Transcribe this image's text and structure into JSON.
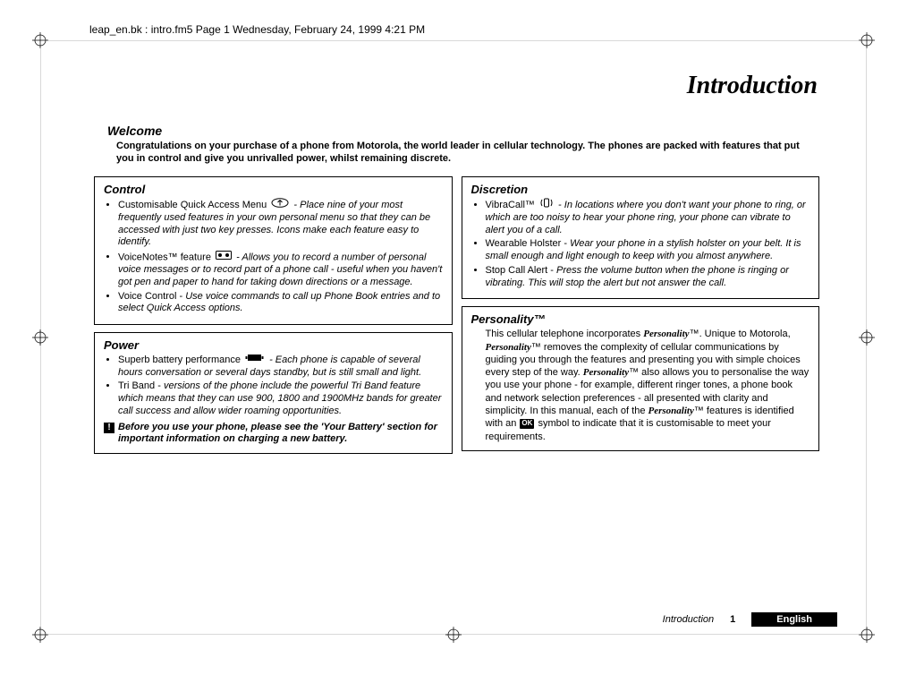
{
  "meta": {
    "line": "leap_en.bk : intro.fm5  Page 1  Wednesday, February 24, 1999  4:21 PM"
  },
  "title": "Introduction",
  "welcome": {
    "heading": "Welcome",
    "body": "Congratulations on your purchase of a phone from Motorola, the world leader in cellular technology. The phones are packed with features that put you in control and give you unrivalled power, whilst remaining discrete."
  },
  "control": {
    "heading": "Control",
    "items": [
      {
        "lead": "Customisable Quick Access Menu ",
        "icon": "up-oval-icon",
        "desc": " - Place nine of your most frequently used features in your own personal menu so that they can be accessed with just two key presses. Icons make each feature easy to identify."
      },
      {
        "lead": "VoiceNotes™ feature ",
        "icon": "tape-icon",
        "desc": " - Allows you to record a number of personal voice messages or to record part of a phone call - useful when you haven't got pen and paper to hand for taking down directions or a message."
      },
      {
        "lead": "Voice Control - ",
        "icon": "",
        "desc": "Use voice commands to call up Phone Book entries and to select Quick Access options."
      }
    ]
  },
  "discretion": {
    "heading": "Discretion",
    "items": [
      {
        "lead": "VibraCall™ ",
        "icon": "vibrate-icon",
        "desc": " - In locations where you don't want your phone to ring, or which are too noisy to hear your phone ring, your phone can vibrate to alert you of a call."
      },
      {
        "lead": "Wearable Holster - ",
        "icon": "",
        "desc": "Wear your phone in a stylish holster on your belt. It is small enough and light enough to keep with you almost anywhere."
      },
      {
        "lead": "Stop Call Alert - ",
        "icon": "",
        "desc": "Press the volume button when the phone is ringing or vibrating. This will stop the alert but not answer the call."
      }
    ]
  },
  "power": {
    "heading": "Power",
    "items": [
      {
        "lead": "Superb battery performance ",
        "icon": "battery-icon",
        "desc": " - Each phone is capable of several hours conversation or several days standby, but is still small and light."
      },
      {
        "lead": "Tri Band - ",
        "icon": "",
        "desc": "versions of the phone include the powerful Tri Band feature which means that they can use 900, 1800 and 1900MHz bands for greater call success and allow wider roaming opportunities."
      }
    ],
    "warning": "Before you use your phone, please see the 'Your Battery' section for important information on charging a new battery."
  },
  "personality": {
    "heading": "Personality™",
    "body_pre": "This cellular telephone incorporates ",
    "pty": "Personality",
    "body_1": "™. Unique to Motorola, ",
    "body_2": "™ removes the complexity of cellular communications by guiding you through the features and presenting you with simple choices every step of the way. ",
    "body_3": "™ also allows you to personalise the way you use your phone - for example, different ringer tones, a phone book and network selection preferences - all presented with clarity and simplicity. In this manual, each of the ",
    "body_4": "™ features is identified with an ",
    "ok": "OK",
    "body_5": " symbol to indicate that it is customisable to meet your requirements."
  },
  "footer": {
    "label": "Introduction",
    "page": "1",
    "lang": "English"
  }
}
